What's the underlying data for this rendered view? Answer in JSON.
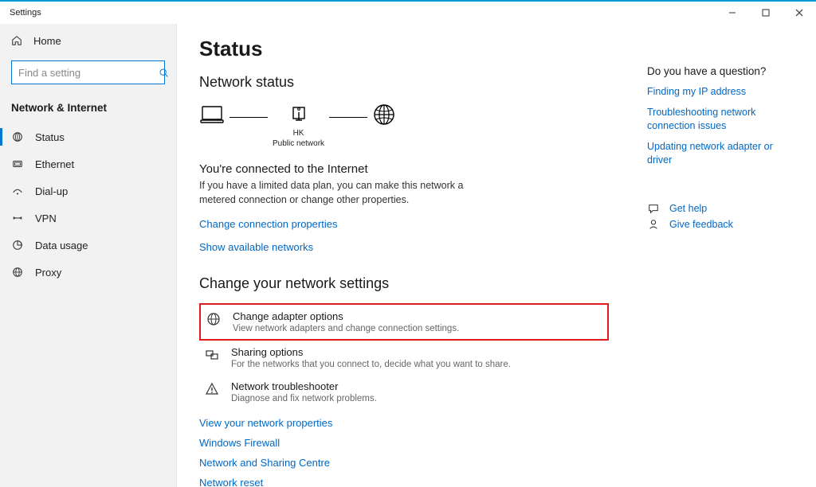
{
  "window": {
    "title": "Settings"
  },
  "sidebar": {
    "home_label": "Home",
    "search_placeholder": "Find a setting",
    "category": "Network & Internet",
    "items": [
      {
        "label": "Status",
        "active": true
      },
      {
        "label": "Ethernet",
        "active": false
      },
      {
        "label": "Dial-up",
        "active": false
      },
      {
        "label": "VPN",
        "active": false
      },
      {
        "label": "Data usage",
        "active": false
      },
      {
        "label": "Proxy",
        "active": false
      }
    ]
  },
  "page": {
    "title": "Status",
    "network_status_head": "Network status",
    "diagram": {
      "router_name": "HK",
      "network_type": "Public network"
    },
    "connected_head": "You're connected to the Internet",
    "connected_desc": "If you have a limited data plan, you can make this network a metered connection or change other properties.",
    "links": {
      "change_conn": "Change connection properties",
      "show_avail": "Show available networks"
    },
    "change_head": "Change your network settings",
    "options": [
      {
        "title": "Change adapter options",
        "desc": "View network adapters and change connection settings.",
        "highlighted": true
      },
      {
        "title": "Sharing options",
        "desc": "For the networks that you connect to, decide what you want to share."
      },
      {
        "title": "Network troubleshooter",
        "desc": "Diagnose and fix network problems."
      }
    ],
    "bottom_links": [
      "View your network properties",
      "Windows Firewall",
      "Network and Sharing Centre",
      "Network reset"
    ]
  },
  "right": {
    "question_head": "Do you have a question?",
    "links": [
      "Finding my IP address",
      "Troubleshooting network connection issues",
      "Updating network adapter or driver"
    ],
    "help_label": "Get help",
    "feedback_label": "Give feedback"
  }
}
